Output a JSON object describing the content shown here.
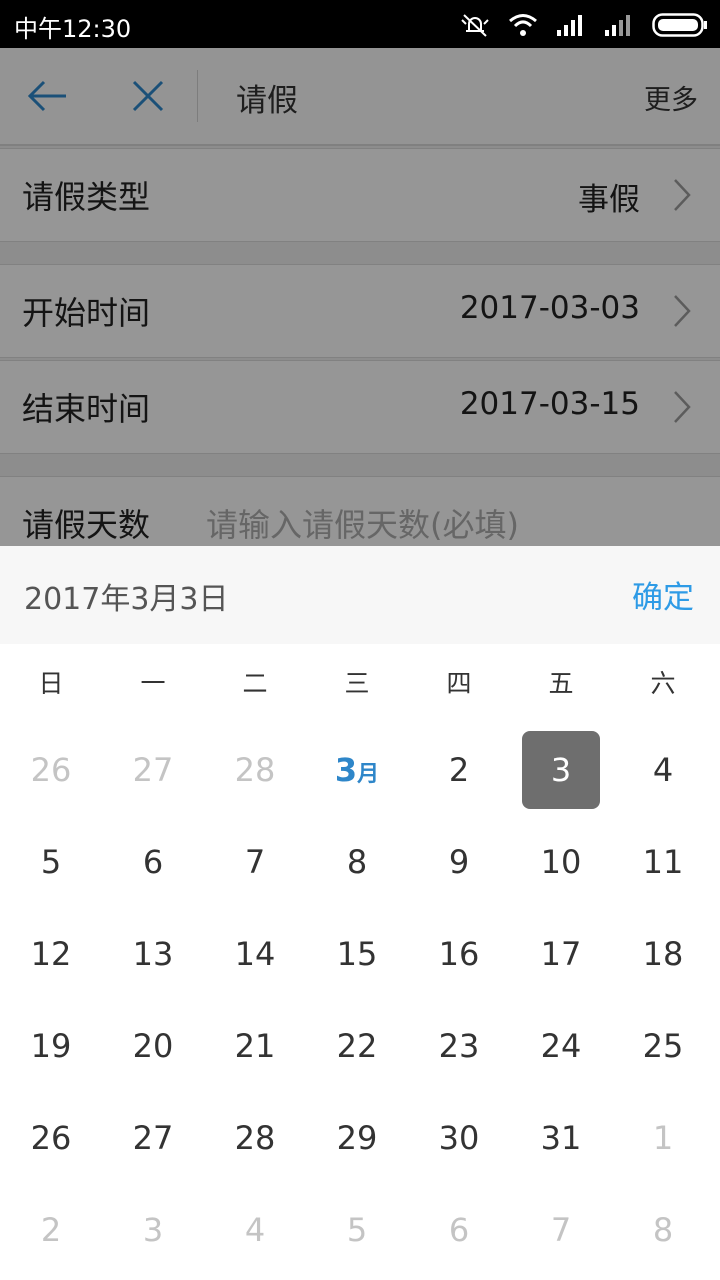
{
  "status_bar": {
    "time": "中午12:30"
  },
  "header": {
    "title": "请假",
    "more_label": "更多"
  },
  "form": {
    "leave_type": {
      "label": "请假类型",
      "value": "事假"
    },
    "start_time": {
      "label": "开始时间",
      "value": "2017-03-03"
    },
    "end_time": {
      "label": "结束时间",
      "value": "2017-03-15"
    },
    "leave_days": {
      "label": "请假天数",
      "placeholder": "请输入请假天数(必填)"
    }
  },
  "picker": {
    "selected_date_text": "2017年3月3日",
    "confirm_label": "确定",
    "weekdays": [
      "日",
      "一",
      "二",
      "三",
      "四",
      "五",
      "六"
    ],
    "month_marker": {
      "number": "3",
      "suffix": "月"
    },
    "weeks": [
      [
        {
          "t": "26",
          "s": "muted"
        },
        {
          "t": "27",
          "s": "muted"
        },
        {
          "t": "28",
          "s": "muted"
        },
        {
          "t": "3",
          "s": "month"
        },
        {
          "t": "2",
          "s": "normal"
        },
        {
          "t": "3",
          "s": "selected"
        },
        {
          "t": "4",
          "s": "normal"
        }
      ],
      [
        {
          "t": "5",
          "s": "normal"
        },
        {
          "t": "6",
          "s": "normal"
        },
        {
          "t": "7",
          "s": "normal"
        },
        {
          "t": "8",
          "s": "normal"
        },
        {
          "t": "9",
          "s": "normal"
        },
        {
          "t": "10",
          "s": "normal"
        },
        {
          "t": "11",
          "s": "normal"
        }
      ],
      [
        {
          "t": "12",
          "s": "normal"
        },
        {
          "t": "13",
          "s": "normal"
        },
        {
          "t": "14",
          "s": "normal"
        },
        {
          "t": "15",
          "s": "normal"
        },
        {
          "t": "16",
          "s": "normal"
        },
        {
          "t": "17",
          "s": "normal"
        },
        {
          "t": "18",
          "s": "normal"
        }
      ],
      [
        {
          "t": "19",
          "s": "normal"
        },
        {
          "t": "20",
          "s": "normal"
        },
        {
          "t": "21",
          "s": "normal"
        },
        {
          "t": "22",
          "s": "normal"
        },
        {
          "t": "23",
          "s": "normal"
        },
        {
          "t": "24",
          "s": "normal"
        },
        {
          "t": "25",
          "s": "normal"
        }
      ],
      [
        {
          "t": "26",
          "s": "normal"
        },
        {
          "t": "27",
          "s": "normal"
        },
        {
          "t": "28",
          "s": "normal"
        },
        {
          "t": "29",
          "s": "normal"
        },
        {
          "t": "30",
          "s": "normal"
        },
        {
          "t": "31",
          "s": "normal"
        },
        {
          "t": "1",
          "s": "muted"
        }
      ],
      [
        {
          "t": "2",
          "s": "muted"
        },
        {
          "t": "3",
          "s": "muted"
        },
        {
          "t": "4",
          "s": "muted"
        },
        {
          "t": "5",
          "s": "muted"
        },
        {
          "t": "6",
          "s": "muted"
        },
        {
          "t": "7",
          "s": "muted"
        },
        {
          "t": "8",
          "s": "muted"
        }
      ]
    ]
  },
  "colors": {
    "accent": "#2e9be6",
    "selected_bg": "#6e6e6e",
    "muted_text": "#c4c4c4"
  },
  "icons": [
    "mute-bell-icon",
    "wifi-icon",
    "signal-icon",
    "battery-icon",
    "back-arrow-icon",
    "close-icon",
    "chevron-right-icon"
  ]
}
